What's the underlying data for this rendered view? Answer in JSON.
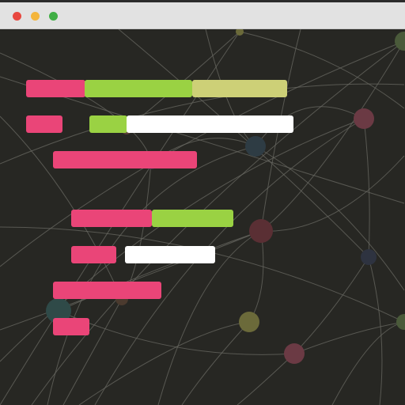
{
  "window": {
    "traffic_lights": {
      "close": "#e8473f",
      "minimize": "#f4b53c",
      "maximize": "#3fae44"
    }
  },
  "colors": {
    "background": "#272723",
    "network_lines": "#6a6a63",
    "pink": "#ea4578",
    "green": "#9ad243",
    "olive": "#cdd077",
    "white": "#ffffff"
  },
  "timeline": {
    "rows": [
      {
        "segments": [
          {
            "color": "pink"
          },
          {
            "color": "green"
          },
          {
            "color": "olive"
          }
        ]
      },
      {
        "segments": [
          {
            "color": "pink"
          },
          {
            "color": "green"
          },
          {
            "color": "white"
          }
        ]
      },
      {
        "segments": [
          {
            "color": "pink"
          }
        ]
      },
      {
        "segments": [
          {
            "color": "pink"
          },
          {
            "color": "green"
          }
        ]
      },
      {
        "segments": [
          {
            "color": "pink"
          },
          {
            "color": "white"
          }
        ]
      },
      {
        "segments": [
          {
            "color": "pink"
          }
        ]
      },
      {
        "segments": [
          {
            "color": "pink"
          }
        ]
      }
    ]
  },
  "network": {
    "node_colors": [
      "#6b6a3a",
      "#4a5a3a",
      "#6b3a44",
      "#2e3c44",
      "#5a3f38",
      "#3a2f44",
      "#5a2f34",
      "#2e3340",
      "#4b3a2e",
      "#2f4a48"
    ]
  }
}
